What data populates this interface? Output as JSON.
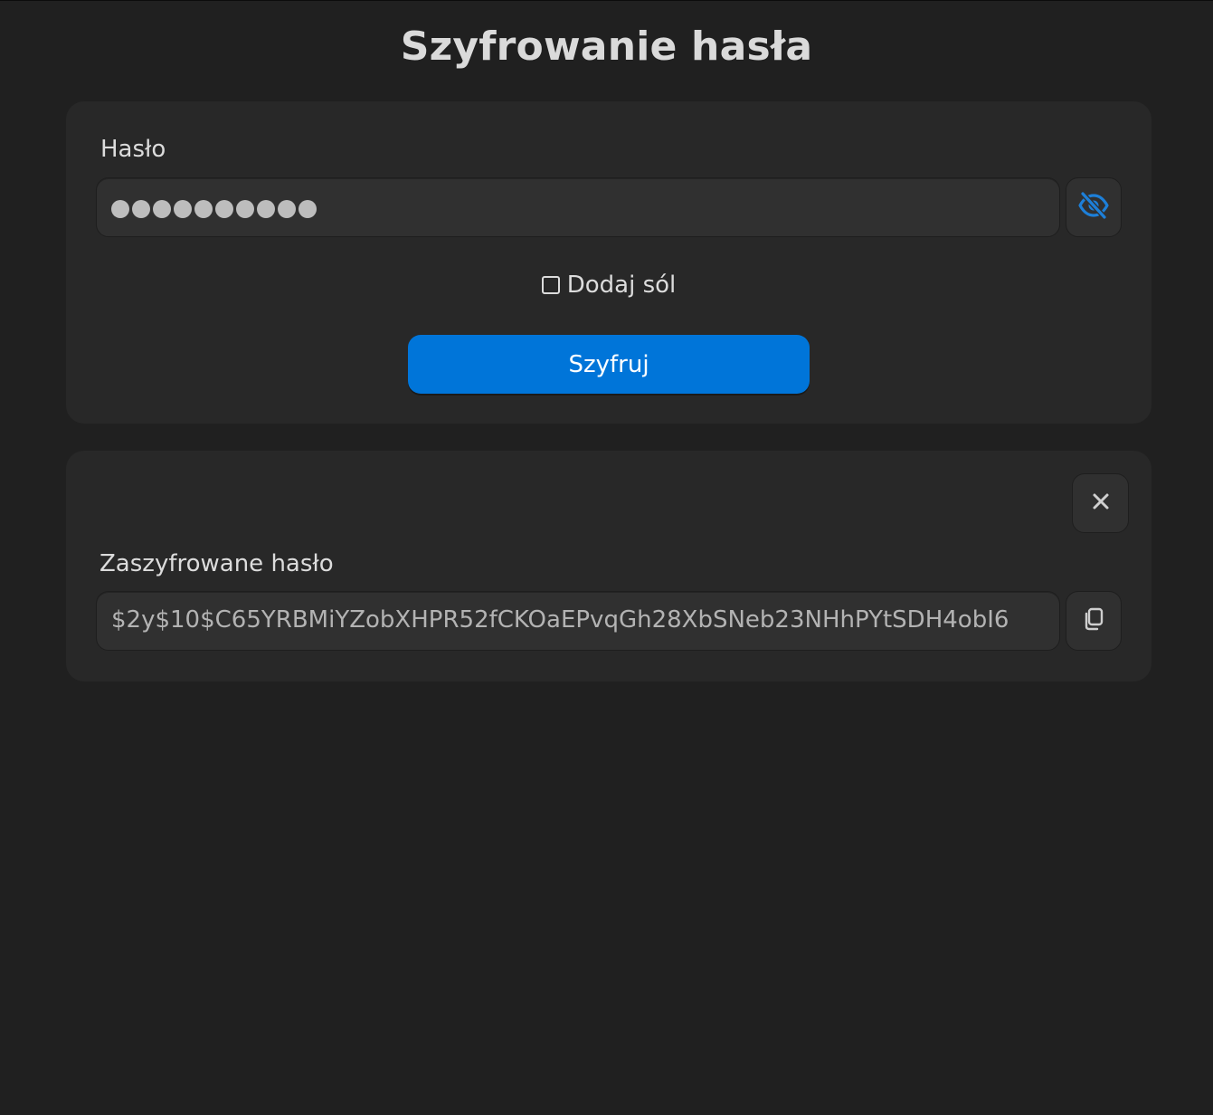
{
  "header": {
    "title": "Szyfrowanie hasła"
  },
  "form": {
    "password_label": "Hasło",
    "password_mask_count": 10,
    "toggle_visibility_icon": "eye-slash-icon",
    "salt_label": "Dodaj sól",
    "salt_checked": false,
    "submit_label": "Szyfruj"
  },
  "result": {
    "close_icon": "close-icon",
    "label": "Zaszyfrowane hasło",
    "hash_value": "$2y$10$C65YRBMiYZobXHPR52fCKOaEPvqGh28XbSNeb23NHhPYtSDH4obI6",
    "copy_icon": "copy-icon"
  },
  "colors": {
    "background": "#202020",
    "card": "#282828",
    "input": "#303030",
    "accent": "#0075d9",
    "text": "#dcdcdc"
  }
}
